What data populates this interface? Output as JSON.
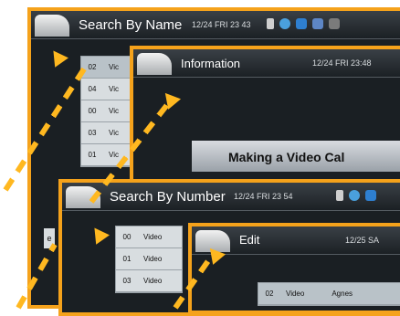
{
  "panels": {
    "search_name": {
      "title": "Search By Name",
      "clock": "12/24 FRI 23 43",
      "rows": [
        {
          "num": "02",
          "text": "Vic"
        },
        {
          "num": "04",
          "text": "Vic"
        },
        {
          "num": "00",
          "text": "Vic"
        },
        {
          "num": "03",
          "text": "Vic"
        },
        {
          "num": "01",
          "text": "Vic"
        }
      ],
      "side_text": "e"
    },
    "information": {
      "title": "Information",
      "clock": "12/24 FRI 23:48",
      "banner": "Making a Video Cal"
    },
    "search_number": {
      "title": "Search By Number",
      "clock": "12/24 FRI 23 54",
      "rows": [
        {
          "num": "00",
          "text": "Video"
        },
        {
          "num": "01",
          "text": "Video"
        },
        {
          "num": "03",
          "text": "Video"
        }
      ]
    },
    "edit": {
      "title": "Edit",
      "clock": "12/25 SA",
      "row": {
        "num": "02",
        "type": "Video",
        "name": "Agnes"
      }
    }
  },
  "colors": {
    "accent": "#f5a21b",
    "arrow": "#ffb820"
  },
  "icons": [
    "lock-icon",
    "disc-icon",
    "card-icon",
    "mic-icon",
    "flag-icon"
  ]
}
